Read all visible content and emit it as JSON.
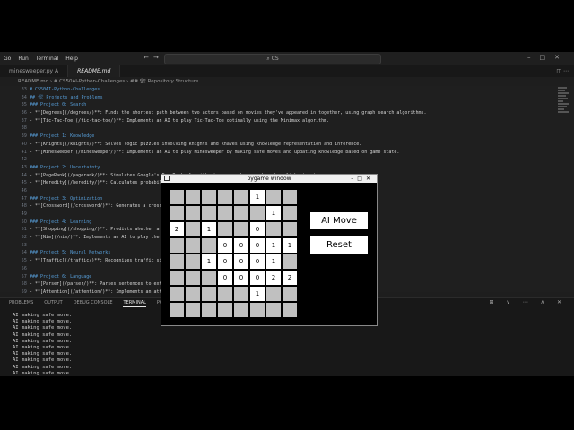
{
  "menu": {
    "items": [
      "Go",
      "Run",
      "Terminal",
      "Help"
    ],
    "search": "CS"
  },
  "tabs": [
    {
      "label": "minesweeper.py  A",
      "active": false
    },
    {
      "label": "README.md",
      "active": true
    }
  ],
  "breadcrumb": "README.md › # CS50AI-Python-Challenges › ## 🏗 Repository Structure",
  "editor": {
    "lines": [
      {
        "n": "33",
        "cls": "h",
        "text": "# CS50AI-Python-Challenges"
      },
      {
        "n": "34",
        "cls": "h",
        "text": "## 🛠 Projects and Problems"
      },
      {
        "n": "35",
        "cls": "h",
        "text": "### Project 0: Search"
      },
      {
        "n": "36",
        "cls": "t",
        "text": " - **[Degrees](/degrees/)**: Finds the shortest path between two actors based on movies they've appeared in together, using graph search algorithms."
      },
      {
        "n": "37",
        "cls": "t",
        "text": " - **[Tic-Tac-Toe](/tic-tac-toe/)**: Implements an AI to play Tic-Tac-Toe optimally using the Minimax algorithm."
      },
      {
        "n": "38",
        "cls": "t",
        "text": ""
      },
      {
        "n": "39",
        "cls": "h",
        "text": "### Project 1: Knowledge"
      },
      {
        "n": "40",
        "cls": "t",
        "text": " - **[Knights](/knights/)**: Solves logic puzzles involving knights and knaves using knowledge representation and inference."
      },
      {
        "n": "41",
        "cls": "t",
        "text": " - **[Minesweeper](/minesweeper/)**: Implements an AI to play Minesweeper by making safe moves and updating knowledge based on game state."
      },
      {
        "n": "42",
        "cls": "t",
        "text": ""
      },
      {
        "n": "43",
        "cls": "h",
        "text": "### Project 2: Uncertainty"
      },
      {
        "n": "44",
        "cls": "t",
        "text": " - **[PageRank](/pagerank/)**: Simulates Google's PageRank algorithm to rank web pages based on link structure."
      },
      {
        "n": "45",
        "cls": "t",
        "text": " - **[Heredity](/heredity/)**: Calculates probabilities of genetic traits in a family tree using Bayesian networks."
      },
      {
        "n": "46",
        "cls": "t",
        "text": ""
      },
      {
        "n": "47",
        "cls": "h",
        "text": "### Project 3: Optimization"
      },
      {
        "n": "48",
        "cls": "t",
        "text": " - **[Crossword](/crossword/)**: Generates a cross                                                              s."
      },
      {
        "n": "49",
        "cls": "t",
        "text": ""
      },
      {
        "n": "50",
        "cls": "h",
        "text": "### Project 4: Learning"
      },
      {
        "n": "51",
        "cls": "t",
        "text": " - **[Shopping](/shopping/)**: Predicts whether a                                                             ssification."
      },
      {
        "n": "52",
        "cls": "t",
        "text": " - **[Nim](/nim/)**: Implements an AI to play the"
      },
      {
        "n": "53",
        "cls": "t",
        "text": ""
      },
      {
        "n": "54",
        "cls": "h",
        "text": "### Project 5: Neural Networks"
      },
      {
        "n": "55",
        "cls": "t",
        "text": " - **[Traffic](/traffic/)**: Recognizes traffic si"
      },
      {
        "n": "56",
        "cls": "t",
        "text": ""
      },
      {
        "n": "57",
        "cls": "h",
        "text": "### Project 6: Language"
      },
      {
        "n": "58",
        "cls": "t",
        "text": " - **[Parser](/parser/)**: Parses sentences to ext"
      },
      {
        "n": "59",
        "cls": "t",
        "text": " - **[Attention](/attention/)**: Implements an att"
      },
      {
        "n": "60",
        "cls": "t",
        "text": ""
      },
      {
        "n": "61",
        "cls": "h",
        "text": "## 🚀 How to Run"
      },
      {
        "n": "62",
        "cls": "t",
        "text": ""
      },
      {
        "n": "63",
        "cls": "t",
        "text": "Each problem can be run by navigating to its fold"
      }
    ]
  },
  "panel": {
    "tabs": [
      "PROBLEMS",
      "OUTPUT",
      "DEBUG CONSOLE",
      "TERMINAL",
      "PORTS"
    ],
    "active_tab": "TERMINAL",
    "terminal_lines": [
      "AI making safe move.",
      "AI making safe move.",
      "AI making safe move.",
      "AI making safe move.",
      "AI making safe move.",
      "AI making safe move.",
      "AI making safe move.",
      "AI making safe move.",
      "AI making safe move.",
      "AI making safe move."
    ]
  },
  "pygame": {
    "title": "pygame window",
    "ai_move_label": "AI Move",
    "reset_label": "Reset",
    "board": [
      [
        "",
        "",
        "",
        "",
        "",
        "1",
        "",
        ""
      ],
      [
        "",
        "",
        "",
        "",
        "",
        "",
        "1",
        ""
      ],
      [
        "2",
        "",
        "1",
        "",
        "",
        "0",
        "",
        ""
      ],
      [
        "",
        "",
        "",
        "0",
        "0",
        "0",
        "1",
        "1"
      ],
      [
        "",
        "",
        "1",
        "0",
        "0",
        "0",
        "1",
        ""
      ],
      [
        "",
        "",
        "",
        "0",
        "0",
        "0",
        "2",
        "2"
      ],
      [
        "",
        "",
        "",
        "",
        "",
        "1",
        "",
        ""
      ],
      [
        "",
        "",
        "",
        "",
        "",
        "",
        "",
        ""
      ]
    ]
  }
}
